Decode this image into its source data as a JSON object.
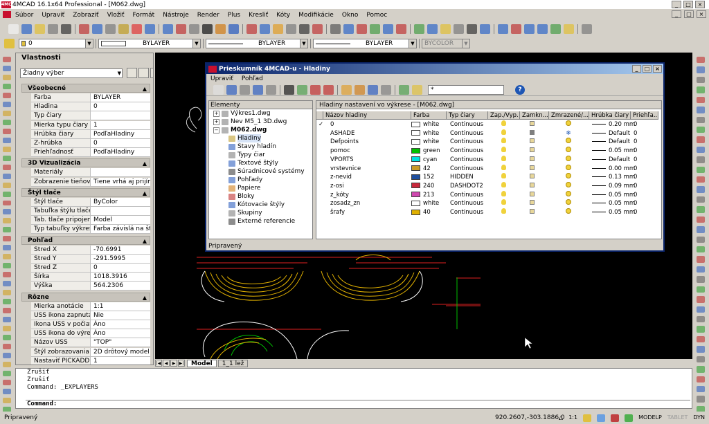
{
  "app": {
    "title": "4MCAD 16.1x64 Professional - [M062.dwg]",
    "logo": "4MCAD"
  },
  "menu": [
    "Súbor",
    "Upraviť",
    "Zobraziť",
    "Vložiť",
    "Formát",
    "Nástroje",
    "Render",
    "Plus",
    "Kresliť",
    "Kóty",
    "Modifikácie",
    "Okno",
    "Pomoc"
  ],
  "toolbar": {
    "layer_value": "0",
    "color_value": "BYLAYER",
    "linetype_value": "BYLAYER",
    "lineweight_value": "BYLAYER",
    "plotstyle_value": "BYCOLOR"
  },
  "properties": {
    "title": "Vlastnosti",
    "selection": "Žiadny výber",
    "sections": [
      {
        "name": "Všeobecné",
        "rows": [
          [
            "Farba",
            "BYLAYER"
          ],
          [
            "Hladina",
            "0"
          ],
          [
            "Typ čiary",
            ""
          ],
          [
            "Mierka typu čiary",
            "1"
          ],
          [
            "Hrúbka čiary",
            "PodľaHladiny"
          ],
          [
            "Z-hrúbka",
            "0"
          ],
          [
            "Priehľadnosť",
            "PodľaHladiny"
          ]
        ]
      },
      {
        "name": "3D Vizualizácia",
        "rows": [
          [
            "Materiály",
            ""
          ],
          [
            "Zobrazenie tieňov",
            "Tiene vrhá aj prijíma"
          ]
        ]
      },
      {
        "name": "Štýl tlače",
        "rows": [
          [
            "Štýl tlače",
            "ByColor"
          ],
          [
            "Tabuľka štýlu tlače",
            ""
          ],
          [
            "Tab. tlače pripojená k",
            "Model"
          ],
          [
            "Typ tabuľky výkresi...",
            "Farba závislá na štýl..."
          ]
        ]
      },
      {
        "name": "Pohľad",
        "rows": [
          [
            "Stred X",
            "-70.6991"
          ],
          [
            "Stred Y",
            "-291.5995"
          ],
          [
            "Stred Z",
            "0"
          ],
          [
            "Šírka",
            "1018.3916"
          ],
          [
            "Výška",
            "564.2306"
          ]
        ]
      },
      {
        "name": "Rôzne",
        "rows": [
          [
            "Mierka anotácie",
            "1:1"
          ],
          [
            "USS ikona zapnutá",
            "Nie"
          ],
          [
            "Ikona USS v počiatku",
            "Áno"
          ],
          [
            "USS ikona do výrezu",
            "Áno"
          ],
          [
            "Názov USS",
            "\"TOP\""
          ],
          [
            "Štýl zobrazovania",
            "2D drôtový model"
          ],
          [
            "Nastaviť PICKADD",
            "1"
          ]
        ]
      }
    ]
  },
  "tabs": [
    "Model",
    "1_1 lež"
  ],
  "command": {
    "lines": [
      "Zrušiť",
      "Zrušiť",
      "Command: _EXPLAYERS"
    ],
    "prompt": "Command:"
  },
  "status": {
    "left": "Pripravený",
    "coords": "920.2607,-303.1886,0",
    "scale": "1:1",
    "buttons": [
      "MODELP",
      "TABLET",
      "DYN"
    ]
  },
  "dialog": {
    "title": "Prieskumník 4MCAD-u - Hladiny",
    "menu": [
      "Upraviť",
      "Pohľad"
    ],
    "search": "*",
    "tree_header": "Elementy",
    "tree": [
      {
        "label": "Výkres1.dwg",
        "level": 0,
        "toggle": "+",
        "bold": false
      },
      {
        "label": "Nev M5_1 3D.dwg",
        "level": 0,
        "toggle": "+",
        "bold": false
      },
      {
        "label": "M062.dwg",
        "level": 0,
        "toggle": "−",
        "bold": true
      },
      {
        "label": "Hladiny",
        "level": 1,
        "toggle": "",
        "bold": false
      },
      {
        "label": "Stavy hladín",
        "level": 1,
        "toggle": "",
        "bold": false
      },
      {
        "label": "Typy čiar",
        "level": 1,
        "toggle": "",
        "bold": false
      },
      {
        "label": "Textové štýly",
        "level": 1,
        "toggle": "",
        "bold": false
      },
      {
        "label": "Súradnicové systémy",
        "level": 1,
        "toggle": "",
        "bold": false
      },
      {
        "label": "Pohľady",
        "level": 1,
        "toggle": "",
        "bold": false
      },
      {
        "label": "Papiere",
        "level": 1,
        "toggle": "",
        "bold": false
      },
      {
        "label": "Bloky",
        "level": 1,
        "toggle": "",
        "bold": false
      },
      {
        "label": "Kótovacie štýly",
        "level": 1,
        "toggle": "",
        "bold": false
      },
      {
        "label": "Skupiny",
        "level": 1,
        "toggle": "",
        "bold": false
      },
      {
        "label": "Externé referencie",
        "level": 1,
        "toggle": "",
        "bold": false
      }
    ],
    "layers_header": "Hladiny nastavení vo výkrese - [M062.dwg]",
    "columns": [
      "Názov hladiny",
      "Farba",
      "Typ čiary",
      "Zap./Vyp.",
      "Zamkn...",
      "Zmrazené/...",
      "Hrúbka čiary",
      "Priehľa..."
    ],
    "layers": [
      {
        "name": "0",
        "color": "white",
        "hex": "#ffffff",
        "linetype": "Continuous",
        "lock": "open",
        "freeze": "sun",
        "lw": "0.20 mm",
        "transp": "0"
      },
      {
        "name": "ASHADE",
        "color": "white",
        "hex": "#ffffff",
        "linetype": "Continuous",
        "lock": "closed",
        "freeze": "snow",
        "lw": "Default",
        "transp": "0"
      },
      {
        "name": "Defpoints",
        "color": "white",
        "hex": "#ffffff",
        "linetype": "Continuous",
        "lock": "open",
        "freeze": "sun",
        "lw": "Default",
        "transp": "0"
      },
      {
        "name": "pomoc",
        "color": "green",
        "hex": "#00c000",
        "linetype": "Continuous",
        "lock": "open",
        "freeze": "sun",
        "lw": "0.05 mm",
        "transp": "0"
      },
      {
        "name": "VPORTS",
        "color": "cyan",
        "hex": "#00e0e0",
        "linetype": "Continuous",
        "lock": "open",
        "freeze": "sun",
        "lw": "Default",
        "transp": "0"
      },
      {
        "name": "vrstevnice",
        "color": "42",
        "hex": "#c89a28",
        "linetype": "Continuous",
        "lock": "open",
        "freeze": "sun",
        "lw": "0.00 mm",
        "transp": "0"
      },
      {
        "name": "z-nevid",
        "color": "152",
        "hex": "#1f4f9e",
        "linetype": "HIDDEN",
        "lock": "open",
        "freeze": "sun",
        "lw": "0.13 mm",
        "transp": "0"
      },
      {
        "name": "z-osi",
        "color": "240",
        "hex": "#c8283c",
        "linetype": "DASHDOT2",
        "lock": "open",
        "freeze": "sun",
        "lw": "0.09 mm",
        "transp": "0"
      },
      {
        "name": "z_kóty",
        "color": "213",
        "hex": "#d048b0",
        "linetype": "Continuous",
        "lock": "open",
        "freeze": "sun",
        "lw": "0.05 mm",
        "transp": "0"
      },
      {
        "name": "zosadz_zn",
        "color": "white",
        "hex": "#ffffff",
        "linetype": "Continuous",
        "lock": "open",
        "freeze": "sun",
        "lw": "0.05 mm",
        "transp": "0"
      },
      {
        "name": "šrafy",
        "color": "40",
        "hex": "#e0b000",
        "linetype": "Continuous",
        "lock": "open",
        "freeze": "sun",
        "lw": "0.05 mm",
        "transp": "0"
      }
    ],
    "status": "Pripravený"
  }
}
